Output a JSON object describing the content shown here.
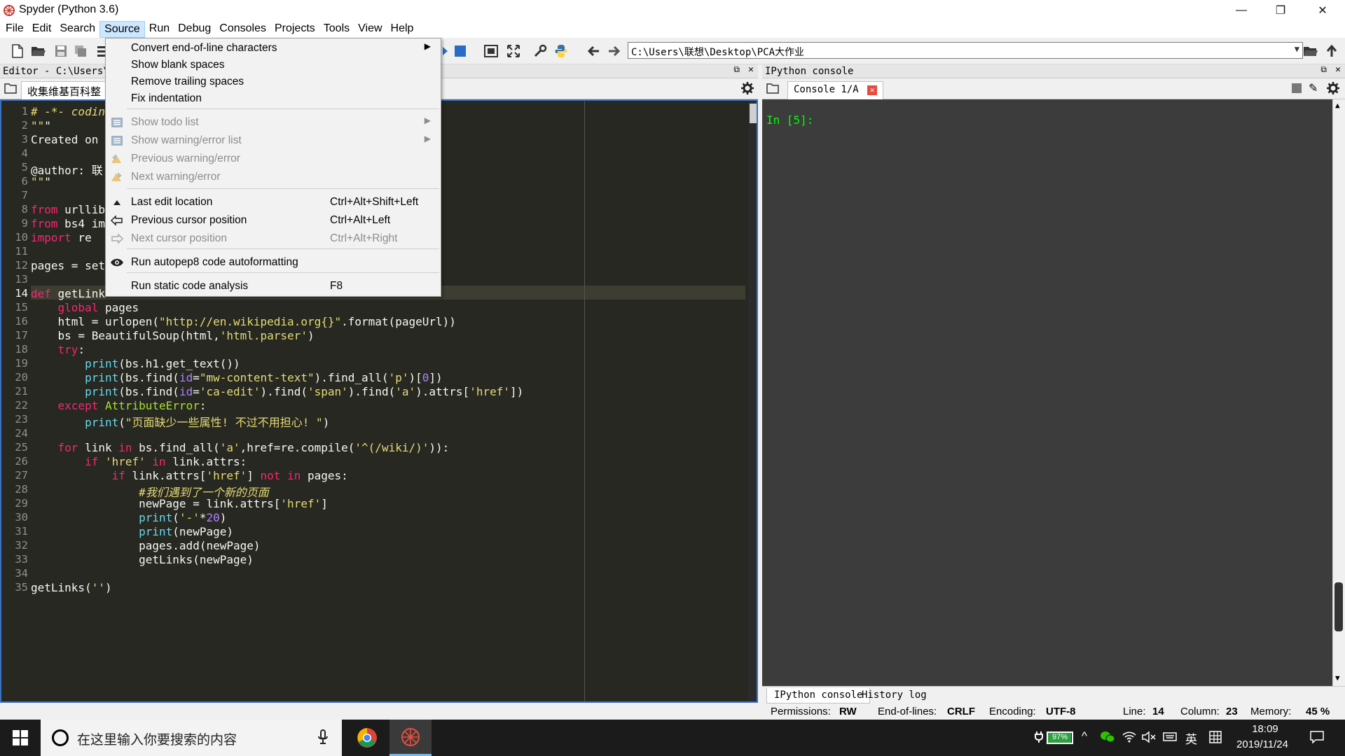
{
  "window": {
    "title": "Spyder (Python 3.6)",
    "minimize": "—",
    "maximize": "❐",
    "close": "✕"
  },
  "menubar": [
    "File",
    "Edit",
    "Search",
    "Source",
    "Run",
    "Debug",
    "Consoles",
    "Projects",
    "Tools",
    "View",
    "Help"
  ],
  "toolbar": {
    "path": "C:\\Users\\联想\\Desktop\\PCA大作业"
  },
  "editor": {
    "header": "Editor - C:\\Users\\",
    "tab": "收集维基百科整",
    "lines": [
      {
        "n": "1",
        "text": "# -*- codin"
      },
      {
        "n": "2",
        "text": "\"\"\""
      },
      {
        "n": "3",
        "text": "Created on"
      },
      {
        "n": "4",
        "text": ""
      },
      {
        "n": "5",
        "text": "@author: 联"
      },
      {
        "n": "6",
        "text": "\"\"\""
      },
      {
        "n": "7",
        "text": ""
      },
      {
        "n": "8",
        "text": "from urllib"
      },
      {
        "n": "9",
        "text": "from bs4 im"
      },
      {
        "n": "10",
        "text": "import re"
      },
      {
        "n": "11",
        "text": ""
      },
      {
        "n": "12",
        "text": "pages = set"
      },
      {
        "n": "13",
        "text": ""
      },
      {
        "n": "14",
        "text": "def getLink"
      },
      {
        "n": "15",
        "text": "    global pages"
      },
      {
        "n": "16",
        "text": "    html = urlopen(\"http://en.wikipedia.org{}\".format(pageUrl))"
      },
      {
        "n": "17",
        "text": "    bs = BeautifulSoup(html,'html.parser')"
      },
      {
        "n": "18",
        "text": "    try:"
      },
      {
        "n": "19",
        "text": "        print(bs.h1.get_text())"
      },
      {
        "n": "20",
        "text": "        print(bs.find(id=\"mw-content-text\").find_all('p')[0])"
      },
      {
        "n": "21",
        "text": "        print(bs.find(id='ca-edit').find('span').find('a').attrs['href'])"
      },
      {
        "n": "22",
        "text": "    except AttributeError:"
      },
      {
        "n": "23",
        "text": "        print(\"页面缺少一些属性! 不过不用担心! \")"
      },
      {
        "n": "24",
        "text": ""
      },
      {
        "n": "25",
        "text": "    for link in bs.find_all('a',href=re.compile('^(/wiki/)')):"
      },
      {
        "n": "26",
        "text": "        if 'href' in link.attrs:"
      },
      {
        "n": "27",
        "text": "            if link.attrs['href'] not in pages:"
      },
      {
        "n": "28",
        "text": "                #我们遇到了一个新的页面"
      },
      {
        "n": "29",
        "text": "                newPage = link.attrs['href']"
      },
      {
        "n": "30",
        "text": "                print('-'*20)"
      },
      {
        "n": "31",
        "text": "                print(newPage)"
      },
      {
        "n": "32",
        "text": "                pages.add(newPage)"
      },
      {
        "n": "33",
        "text": "                getLinks(newPage)"
      },
      {
        "n": "34",
        "text": ""
      },
      {
        "n": "35",
        "text": "getLinks('')"
      }
    ]
  },
  "console": {
    "header": "IPython console",
    "tab": "Console 1/A",
    "prompt": "In [5]:",
    "bottom_tabs": [
      "IPython console",
      "History log"
    ]
  },
  "source_menu": {
    "items": [
      {
        "label": "Convert end-of-line characters",
        "shortcut": "",
        "submenu": true,
        "disabled": false,
        "icon": ""
      },
      {
        "label": "Show blank spaces",
        "shortcut": "",
        "submenu": false,
        "disabled": false,
        "icon": ""
      },
      {
        "label": "Remove trailing spaces",
        "shortcut": "",
        "submenu": false,
        "disabled": false,
        "icon": ""
      },
      {
        "label": "Fix indentation",
        "shortcut": "",
        "submenu": false,
        "disabled": false,
        "icon": ""
      },
      {
        "label": "Show todo list",
        "shortcut": "",
        "submenu": true,
        "disabled": true,
        "icon": "todo-list-icon"
      },
      {
        "label": "Show warning/error list",
        "shortcut": "",
        "submenu": true,
        "disabled": true,
        "icon": "warning-list-icon"
      },
      {
        "label": "Previous warning/error",
        "shortcut": "",
        "submenu": false,
        "disabled": true,
        "icon": "prev-warning-icon"
      },
      {
        "label": "Next warning/error",
        "shortcut": "",
        "submenu": false,
        "disabled": true,
        "icon": "next-warning-icon"
      },
      {
        "label": "Last edit location",
        "shortcut": "Ctrl+Alt+Shift+Left",
        "submenu": false,
        "disabled": false,
        "icon": "last-edit-icon"
      },
      {
        "label": "Previous cursor position",
        "shortcut": "Ctrl+Alt+Left",
        "submenu": false,
        "disabled": false,
        "icon": "prev-cursor-icon"
      },
      {
        "label": "Next cursor position",
        "shortcut": "Ctrl+Alt+Right",
        "submenu": false,
        "disabled": true,
        "icon": "next-cursor-icon"
      },
      {
        "label": "Run autopep8 code autoformatting",
        "shortcut": "",
        "submenu": false,
        "disabled": false,
        "icon": "eye-icon"
      },
      {
        "label": "Run static code analysis",
        "shortcut": "F8",
        "submenu": false,
        "disabled": false,
        "icon": ""
      }
    ]
  },
  "statusbar": {
    "permissions_label": "Permissions:",
    "permissions": "RW",
    "eol_label": "End-of-lines:",
    "eol": "CRLF",
    "encoding_label": "Encoding:",
    "encoding": "UTF-8",
    "line_label": "Line:",
    "line": "14",
    "column_label": "Column:",
    "column": "23",
    "memory_label": "Memory:",
    "memory": "45 %"
  },
  "taskbar": {
    "search_placeholder": "在这里输入你要搜索的内容",
    "battery": "97%",
    "battery_level": 0.97,
    "ime": "英",
    "time": "18:09",
    "date": "2019/11/24"
  },
  "colors": {
    "editor_bg": "#272822",
    "console_bg": "#3c3c3c",
    "prompt": "#00ff00",
    "menu_active": "#cce8ff"
  }
}
